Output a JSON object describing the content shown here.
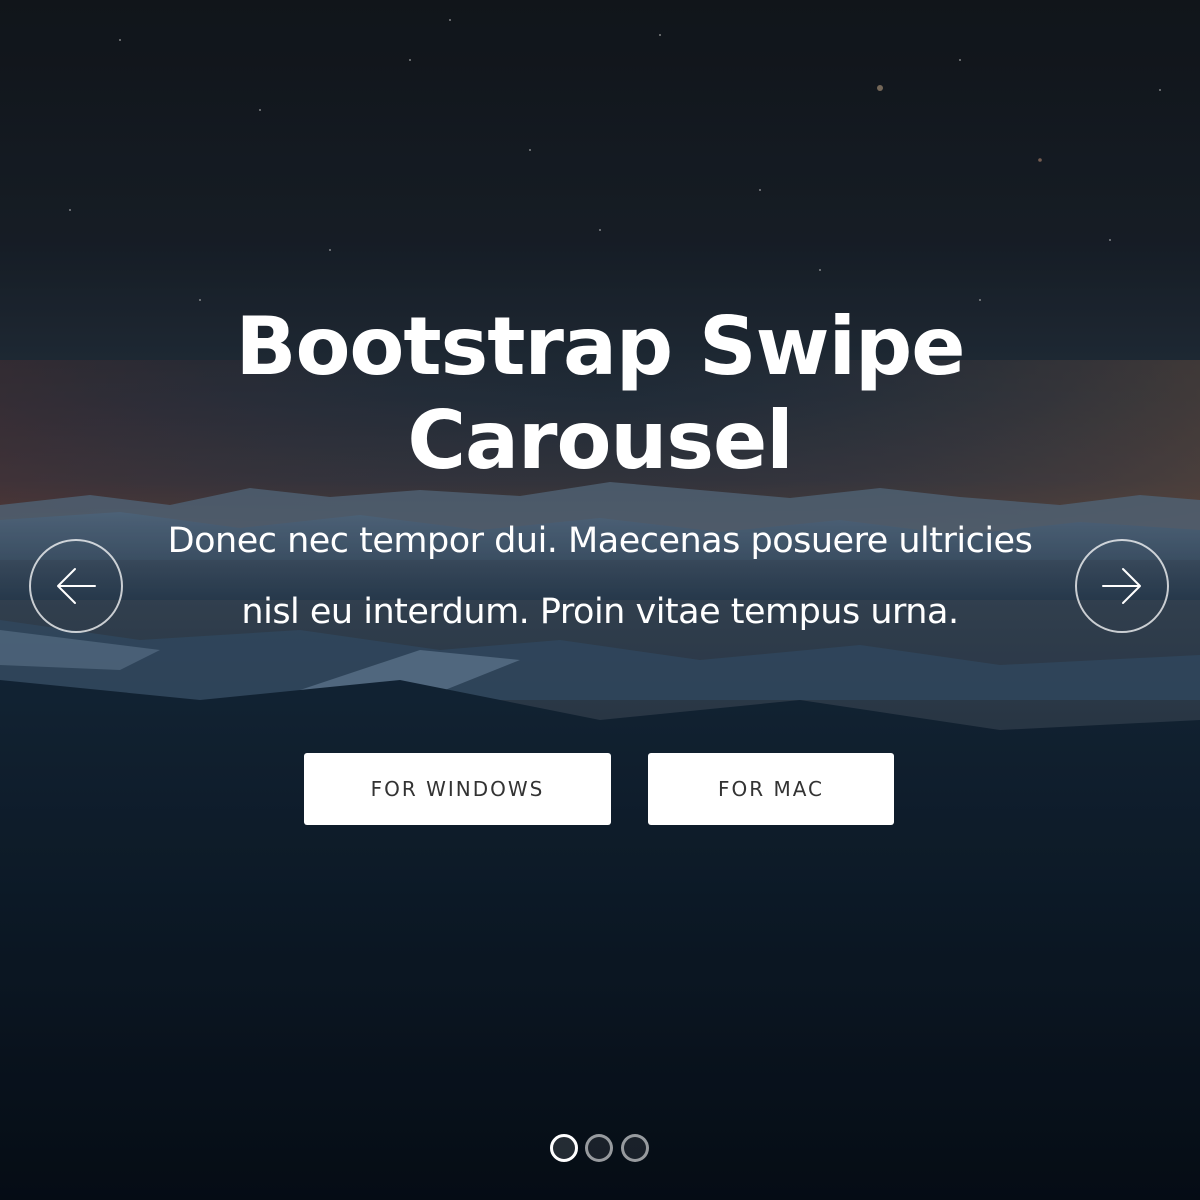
{
  "slide": {
    "title": "Bootstrap Swipe Carousel",
    "text": "Donec nec tempor dui. Maecenas posuere ultricies nisl eu interdum. Proin vitae tempus urna.",
    "buttons": {
      "windows_label": "FOR WINDOWS",
      "mac_label": "FOR MAC"
    }
  },
  "controls": {
    "prev_icon": "arrow-left-icon",
    "next_icon": "arrow-right-icon"
  },
  "indicators": {
    "count": 3,
    "active_index": 0
  },
  "colors": {
    "text": "#ffffff",
    "button_bg": "#ffffff",
    "button_text": "#333333",
    "sky_top": "#14191f",
    "sky_horizon": "#4a3f3e",
    "forest": "#0b1825"
  }
}
